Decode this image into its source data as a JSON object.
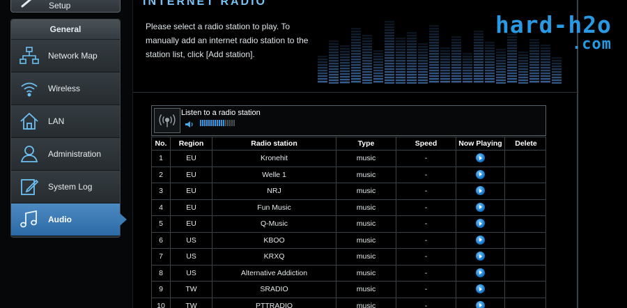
{
  "sidebar": {
    "setup_label": "Setup",
    "group_title": "General",
    "items": [
      {
        "label": "Network Map",
        "icon": "network-map-icon",
        "active": false
      },
      {
        "label": "Wireless",
        "icon": "wifi-icon",
        "active": false
      },
      {
        "label": "LAN",
        "icon": "home-icon",
        "active": false
      },
      {
        "label": "Administration",
        "icon": "user-admin-icon",
        "active": false
      },
      {
        "label": "System Log",
        "icon": "system-log-icon",
        "active": false
      },
      {
        "label": "Audio",
        "icon": "music-note-icon",
        "active": true
      }
    ]
  },
  "main": {
    "title": "INTERNET RADIO",
    "description": "Please select a radio station to play. To manually add an internet radio station to the station list, click [Add station].",
    "player": {
      "label": "Listen to a radio station",
      "volume_level": 0.7
    },
    "table": {
      "headers": [
        "No.",
        "Region",
        "Radio station",
        "Type",
        "Speed",
        "Now Playing",
        "Delete"
      ],
      "rows": [
        {
          "no": "1",
          "region": "EU",
          "station": "Kronehit",
          "type": "music",
          "speed": "-"
        },
        {
          "no": "2",
          "region": "EU",
          "station": "Welle 1",
          "type": "music",
          "speed": "-"
        },
        {
          "no": "3",
          "region": "EU",
          "station": "NRJ",
          "type": "music",
          "speed": "-"
        },
        {
          "no": "4",
          "region": "EU",
          "station": "Fun Music",
          "type": "music",
          "speed": "-"
        },
        {
          "no": "5",
          "region": "EU",
          "station": "Q-Music",
          "type": "music",
          "speed": "-"
        },
        {
          "no": "6",
          "region": "US",
          "station": "KBOO",
          "type": "music",
          "speed": "-"
        },
        {
          "no": "7",
          "region": "US",
          "station": "KRXQ",
          "type": "music",
          "speed": "-"
        },
        {
          "no": "8",
          "region": "US",
          "station": "Alternative Addiction",
          "type": "music",
          "speed": "-"
        },
        {
          "no": "9",
          "region": "TW",
          "station": "SRADIO",
          "type": "music",
          "speed": "-"
        },
        {
          "no": "10",
          "region": "TW",
          "station": "PTTRADIO",
          "type": "music",
          "speed": "-"
        }
      ]
    }
  },
  "watermark": {
    "line1": "hard-h2o",
    "line2": ".com"
  },
  "colors": {
    "accent": "#2899e2",
    "title": "#7cc4f4",
    "active_nav": "#3d7bb6"
  }
}
